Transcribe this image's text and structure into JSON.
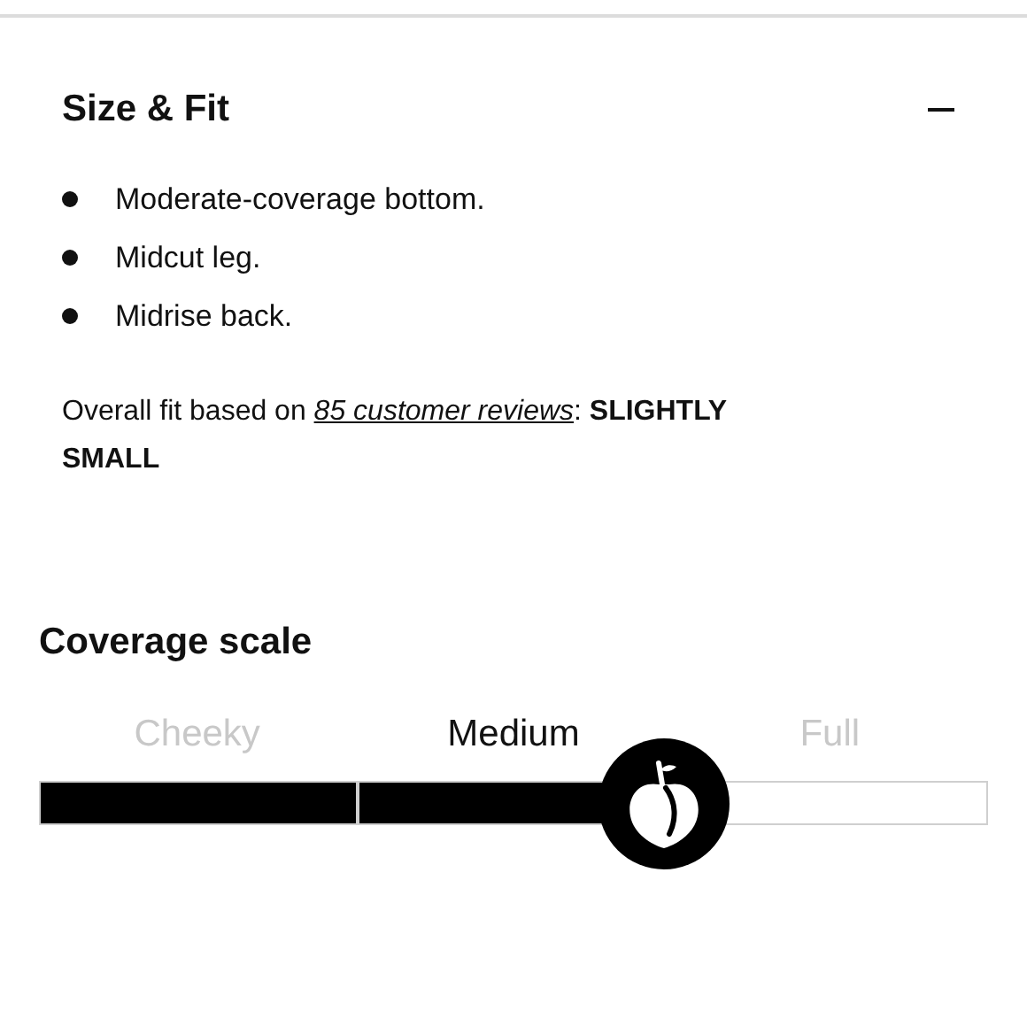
{
  "section": {
    "title": "Size & Fit",
    "expanded": true,
    "bullets": [
      "Moderate-coverage bottom.",
      "Midcut leg.",
      "Midrise back."
    ],
    "fit_summary": {
      "before": "Overall fit based on ",
      "link": "85 customer reviews",
      "after": ": **SLIGHTLY SMALL**"
    }
  },
  "coverage_scale": {
    "title": "Coverage scale",
    "level": 0.66,
    "options": [
      {
        "label": "Cheeky",
        "selected": false
      },
      {
        "label": "Medium",
        "selected": true
      },
      {
        "label": "Full",
        "selected": false
      }
    ]
  }
}
